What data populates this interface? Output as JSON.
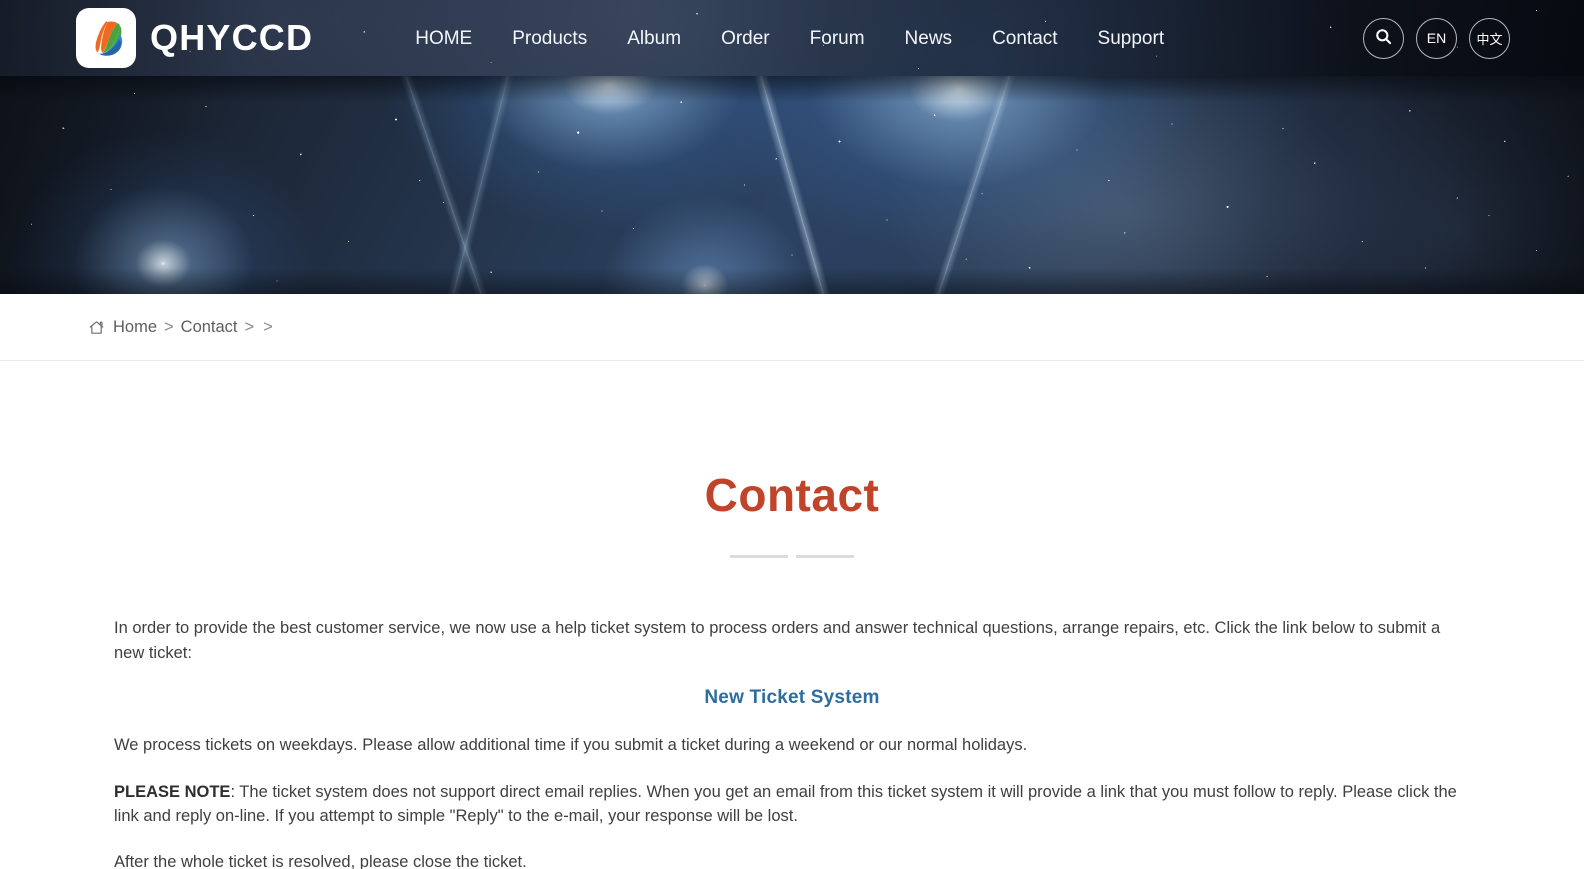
{
  "header": {
    "brand_name": "QHYCCD",
    "logo_icon": "qhyccd-swoosh-logo",
    "nav": [
      {
        "label": "HOME"
      },
      {
        "label": "Products"
      },
      {
        "label": "Album"
      },
      {
        "label": "Order"
      },
      {
        "label": "Forum"
      },
      {
        "label": "News"
      },
      {
        "label": "Contact"
      },
      {
        "label": "Support"
      }
    ],
    "actions": {
      "search_icon": "search-icon",
      "lang_en": "EN",
      "lang_cn": "中文"
    },
    "background_color": "#0a0d14"
  },
  "banner": {
    "icon": "star-field-nebula-image",
    "alt": "Star field with bright blue stars and nebulosity"
  },
  "breadcrumb": {
    "home_icon": "home-icon",
    "items": [
      {
        "label": "Home"
      },
      {
        "label": "Contact"
      }
    ],
    "separator": ">",
    "trailing": ">"
  },
  "page": {
    "title": "Contact",
    "title_color": "#c0442a",
    "divider_color": "#dcdcdc"
  },
  "content": {
    "intro": "In order to provide the best customer service, we now use a help ticket system to process orders and answer technical questions, arrange repairs, etc.  Click the link below to submit a new ticket:",
    "ticket_link": "New Ticket System",
    "ticket_link_color": "#2d6e9e",
    "weekdays_note": "We process tickets on weekdays.  Please allow additional time if you submit a ticket during a weekend or our normal holidays.",
    "please_note_label": "PLEASE NOTE",
    "please_note_body": ": The ticket system does not support direct email replies.  When you get an email from this ticket system it will provide a link that you must follow to reply.  Please click the link and reply on-line.  If you attempt to simple \"Reply\" to the e-mail, your response will be lost.",
    "close_note": "After the whole ticket is resolved, please close the ticket."
  }
}
